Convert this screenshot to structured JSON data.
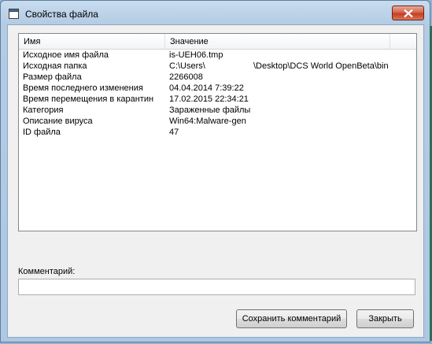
{
  "window": {
    "title": "Свойства файла"
  },
  "list": {
    "columns": [
      "Имя",
      "Значение",
      ""
    ],
    "rows": [
      {
        "name": "Исходное имя файла",
        "value": "is-UEH06.tmp"
      },
      {
        "name": "Исходная папка",
        "value": "C:\\Users\\                    \\Desktop\\DCS World OpenBeta\\bin"
      },
      {
        "name": "Размер файла",
        "value": "2266008"
      },
      {
        "name": "Время последнего изменения",
        "value": "04.04.2014 7:39:22"
      },
      {
        "name": "Время перемещения в карантин",
        "value": "17.02.2015 22:34:21"
      },
      {
        "name": "Категория",
        "value": "Зараженные файлы"
      },
      {
        "name": "Описание вируса",
        "value": "Win64:Malware-gen"
      },
      {
        "name": "ID файла",
        "value": "47"
      }
    ]
  },
  "comment": {
    "label": "Комментарий:",
    "value": ""
  },
  "buttons": {
    "save_comment": "Сохранить комментарий",
    "close": "Закрыть"
  },
  "icons": {
    "window_icon": "window-icon",
    "close_icon": "close-icon"
  },
  "colors": {
    "close_button": "#c43d20",
    "window_frame": "#b3cbe3"
  }
}
